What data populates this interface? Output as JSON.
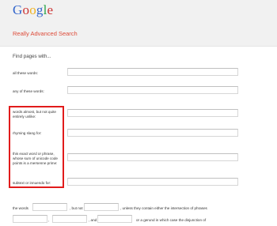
{
  "header": {
    "logo": "Google",
    "title": "Really Advanced Search"
  },
  "form": {
    "section_heading": "Find pages with...",
    "rows": [
      {
        "label": "all these words:",
        "value": ""
      },
      {
        "label": "any of these words:",
        "value": ""
      },
      {
        "label": "words almost, but not quite entirely unlike:",
        "value": ""
      },
      {
        "label": "rhyming slang for:",
        "value": ""
      },
      {
        "label": "this exact word or phrase, whose sum of unicode code points is a mersenne prime:",
        "value": ""
      },
      {
        "label": "subtext or innuendo for:",
        "value": ""
      }
    ],
    "sentence": {
      "part1": "the words",
      "part2": ", but not",
      "part3": ", unless they contain either the intersection of phrases",
      "part4": ",",
      "part5": ", and",
      "part6": "or a gerund in which case the disjunction of"
    }
  },
  "colors": {
    "title_red": "#dd4b39",
    "highlight_red": "#e11b1b"
  }
}
